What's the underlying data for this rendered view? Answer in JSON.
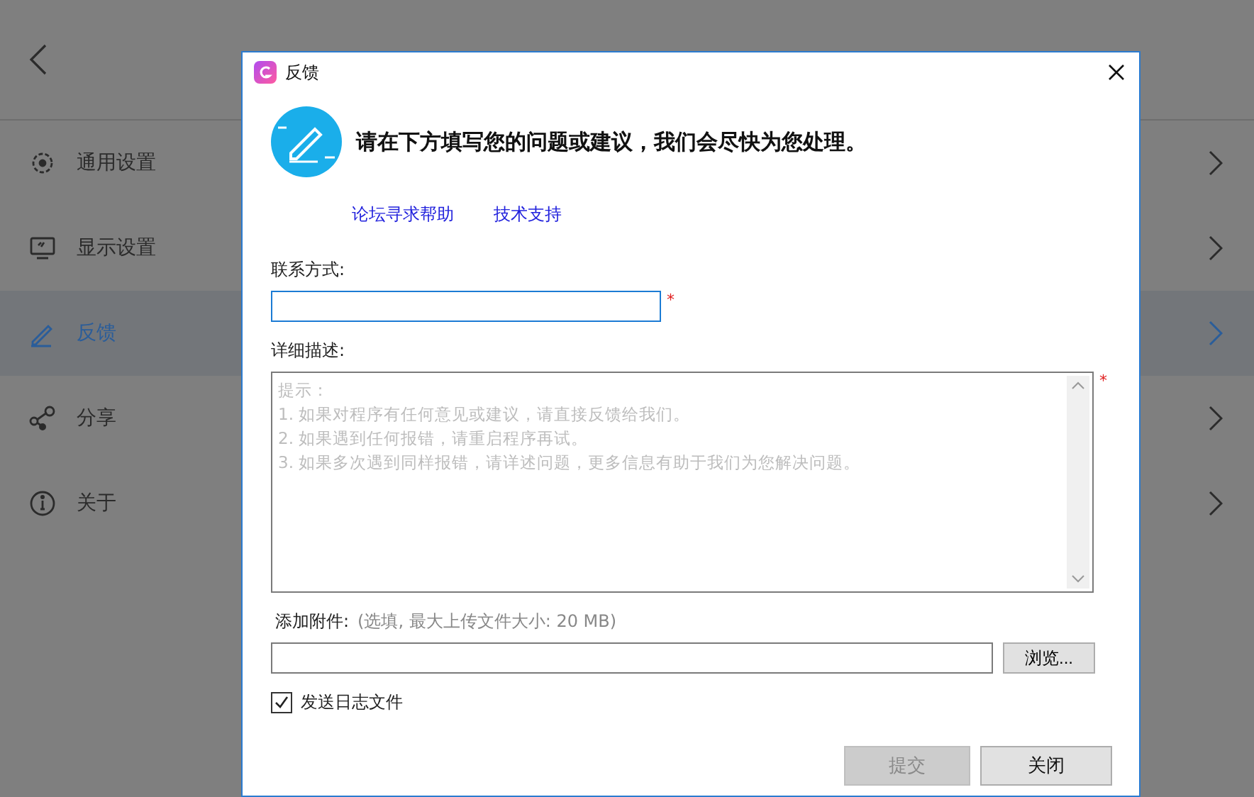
{
  "settings_menu": [
    {
      "label": "通用设置",
      "selected": false,
      "kind": "gear"
    },
    {
      "label": "显示设置",
      "selected": false,
      "kind": "monitor"
    },
    {
      "label": "反馈",
      "selected": true,
      "kind": "pencil"
    },
    {
      "label": "分享",
      "selected": false,
      "kind": "share"
    },
    {
      "label": "关于",
      "selected": false,
      "kind": "info"
    }
  ],
  "dialog": {
    "title": "反馈",
    "heading": "请在下方填写您的问题或建议，我们会尽快为您处理。",
    "links": [
      "论坛寻求帮助",
      "技术支持"
    ],
    "contact": {
      "label": "联系方式:",
      "required_mark": "*"
    },
    "description": {
      "label": "详细描述:",
      "required_mark": "*",
      "placeholder": "提示：\n1. 如果对程序有任何意见或建议，请直接反馈给我们。\n2. 如果遇到任何报错，请重启程序再试。\n3. 如果多次遇到同样报错，请详述问题，更多信息有助于我们为您解决问题。"
    },
    "attachment": {
      "label": "添加附件:",
      "hint": "(选填, 最大上传文件大小: 20 MB)",
      "browse": "浏览..."
    },
    "send_log": {
      "label": "发送日志文件",
      "checked": true
    },
    "buttons": [
      {
        "label": "提交",
        "disabled": true
      },
      {
        "label": "关闭",
        "disabled": false
      }
    ]
  }
}
